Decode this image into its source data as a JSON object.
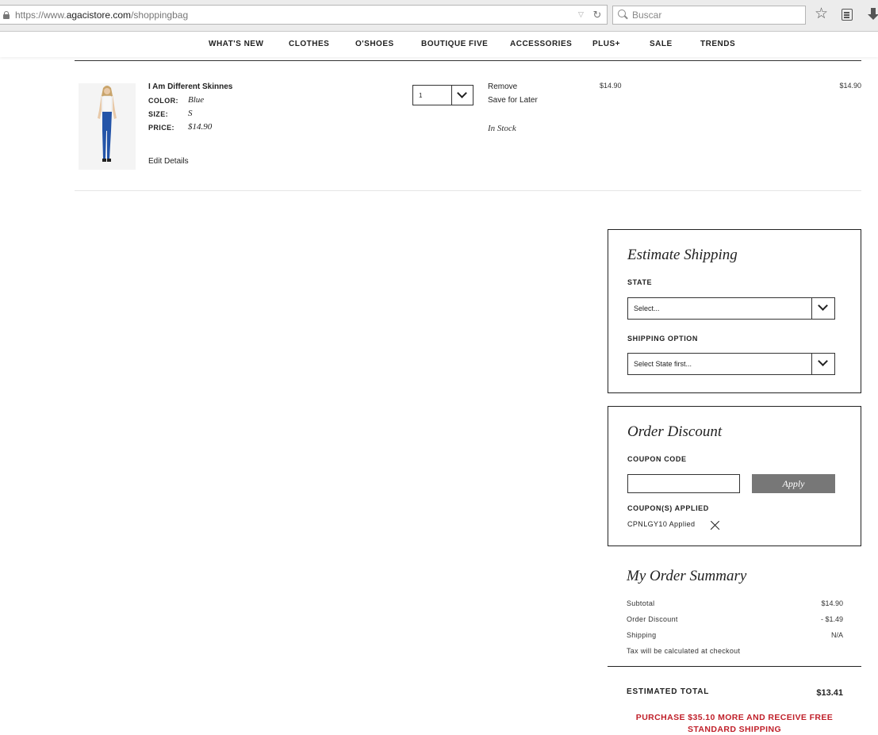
{
  "browser": {
    "url_prefix": "https://www.",
    "url_domain": "agacistore.com",
    "url_path": "/shoppingbag",
    "search_placeholder": "Buscar"
  },
  "nav": {
    "items": [
      "WHAT'S NEW",
      "CLOTHES",
      "O'SHOES",
      "BOUTIQUE FIVE",
      "ACCESSORIES",
      "PLUS+",
      "SALE",
      "TRENDS"
    ]
  },
  "cart_item": {
    "name": "I Am Different Skinnes",
    "color_label": "COLOR:",
    "color_value": "Blue",
    "size_label": "SIZE:",
    "size_value": "S",
    "price_label": "PRICE:",
    "price_value": "$14.90",
    "edit_label": "Edit Details",
    "quantity": "1",
    "remove_label": "Remove",
    "save_label": "Save for Later",
    "stock_status": "In Stock",
    "unit_price": "$14.90",
    "line_total": "$14.90"
  },
  "shipping": {
    "title": "Estimate Shipping",
    "state_label": "STATE",
    "state_value": "Select...",
    "option_label": "SHIPPING OPTION",
    "option_value": "Select State first..."
  },
  "discount": {
    "title": "Order Discount",
    "coupon_label": "COUPON CODE",
    "coupon_value": "",
    "apply_label": "Apply",
    "applied_label": "COUPON(S) APPLIED",
    "applied_coupon": "CPNLGY10 Applied"
  },
  "summary": {
    "title": "My Order Summary",
    "subtotal_label": "Subtotal",
    "subtotal_value": "$14.90",
    "discount_label": "Order Discount",
    "discount_value": "- $1.49",
    "shipping_label": "Shipping",
    "shipping_value": "N/A",
    "tax_note": "Tax will be calculated at checkout",
    "total_label": "ESTIMATED TOTAL",
    "total_value": "$13.41",
    "promo": "PURCHASE $35.10 MORE AND RECEIVE FREE STANDARD SHIPPING"
  }
}
